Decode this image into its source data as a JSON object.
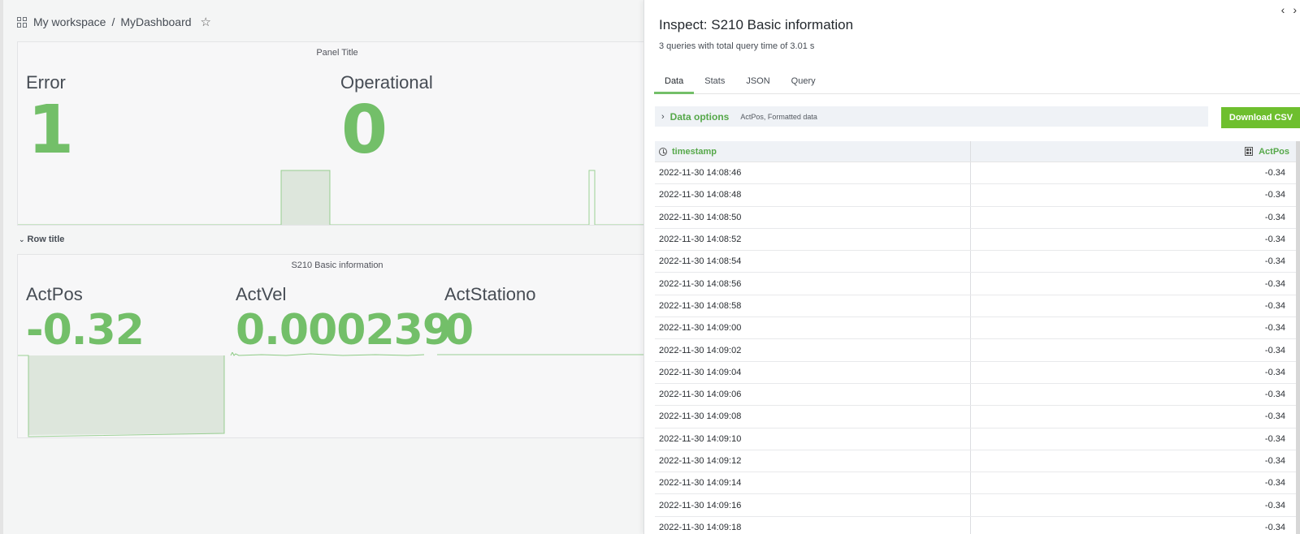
{
  "breadcrumb": {
    "workspace": "My workspace",
    "separator": "/",
    "dashboard": "MyDashboard"
  },
  "top_panel": {
    "title": "Panel Title",
    "stats": [
      {
        "label": "Error",
        "value": "1"
      },
      {
        "label": "Operational",
        "value": "0"
      }
    ]
  },
  "row": {
    "title": "Row title"
  },
  "bottom_panel": {
    "title": "S210 Basic information",
    "stats": [
      {
        "label": "ActPos",
        "value": "-0.32"
      },
      {
        "label": "ActVel",
        "value": "0.000239"
      },
      {
        "label": "ActStationo",
        "value": "0"
      }
    ]
  },
  "colors": {
    "stat_green": "#73bf69",
    "button_green": "#6ebf2e"
  },
  "inspect": {
    "title": "Inspect: S210 Basic information",
    "subtitle": "3 queries with total query time of 3.01 s",
    "tabs": [
      {
        "label": "Data",
        "active": true
      },
      {
        "label": "Stats",
        "active": false
      },
      {
        "label": "JSON",
        "active": false
      },
      {
        "label": "Query",
        "active": false
      }
    ],
    "data_options": {
      "label": "Data options",
      "description": "ActPos, Formatted data"
    },
    "download_csv_label": "Download CSV",
    "controls": {
      "collapse": "‹",
      "expand": "›"
    },
    "table": {
      "headers": [
        "timestamp",
        "ActPos"
      ],
      "header_icons": [
        "clock-icon",
        "calculator-icon"
      ],
      "rows": [
        [
          "2022-11-30 14:08:46",
          "-0.34"
        ],
        [
          "2022-11-30 14:08:48",
          "-0.34"
        ],
        [
          "2022-11-30 14:08:50",
          "-0.34"
        ],
        [
          "2022-11-30 14:08:52",
          "-0.34"
        ],
        [
          "2022-11-30 14:08:54",
          "-0.34"
        ],
        [
          "2022-11-30 14:08:56",
          "-0.34"
        ],
        [
          "2022-11-30 14:08:58",
          "-0.34"
        ],
        [
          "2022-11-30 14:09:00",
          "-0.34"
        ],
        [
          "2022-11-30 14:09:02",
          "-0.34"
        ],
        [
          "2022-11-30 14:09:04",
          "-0.34"
        ],
        [
          "2022-11-30 14:09:06",
          "-0.34"
        ],
        [
          "2022-11-30 14:09:08",
          "-0.34"
        ],
        [
          "2022-11-30 14:09:10",
          "-0.34"
        ],
        [
          "2022-11-30 14:09:12",
          "-0.34"
        ],
        [
          "2022-11-30 14:09:14",
          "-0.34"
        ],
        [
          "2022-11-30 14:09:16",
          "-0.34"
        ],
        [
          "2022-11-30 14:09:18",
          "-0.34"
        ]
      ]
    }
  }
}
